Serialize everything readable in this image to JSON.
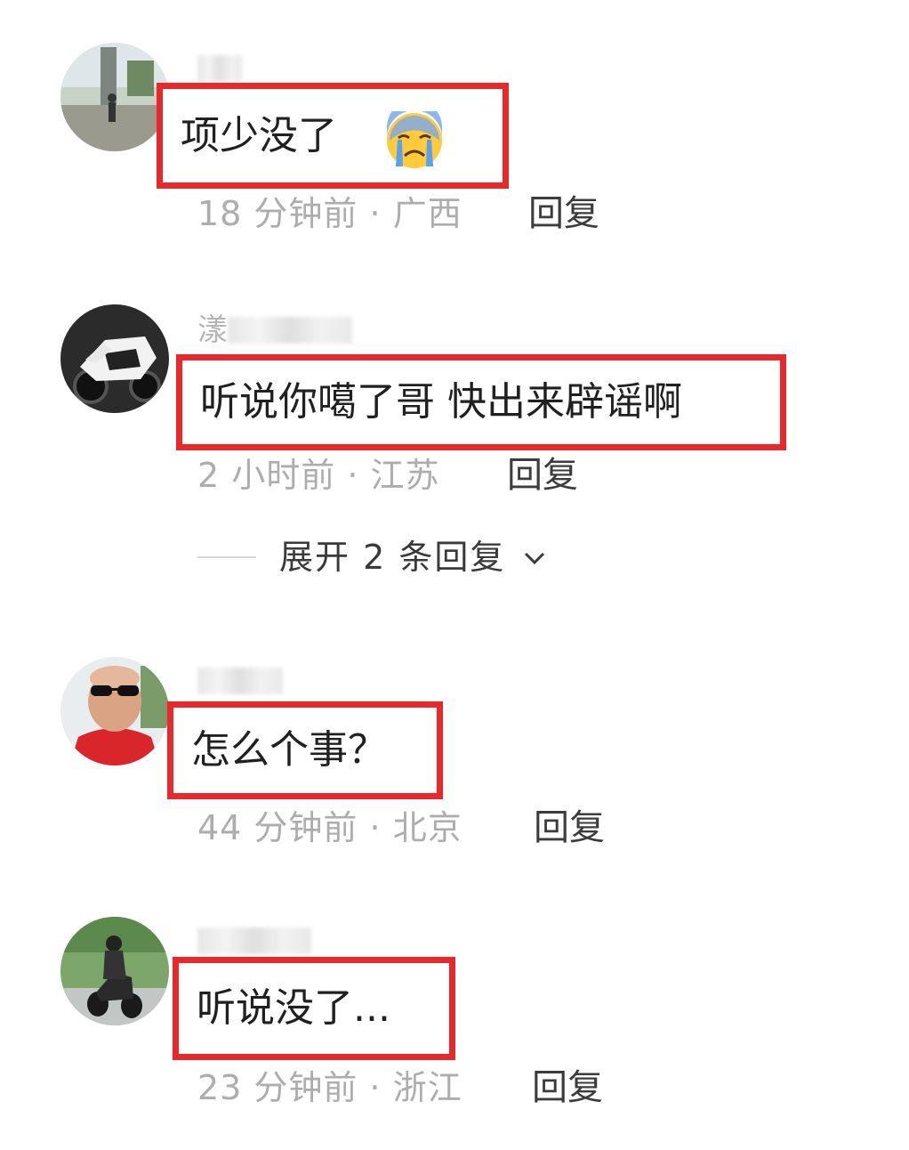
{
  "comments": [
    {
      "username": "",
      "text": "项少没了",
      "emoji": "loudly-crying-face",
      "time": "18 分钟前",
      "location": "广西",
      "reply_label": "回复"
    },
    {
      "username": "漾",
      "text": "听说你噶了哥 快出来辟谣啊",
      "time": "2 小时前",
      "location": "江苏",
      "reply_label": "回复",
      "expand_label": "展开 2 条回复"
    },
    {
      "username": "",
      "text": "怎么个事？",
      "time": "44 分钟前",
      "location": "北京",
      "reply_label": "回复"
    },
    {
      "username": "",
      "text": "听说没了...",
      "time": "23 分钟前",
      "location": "浙江",
      "reply_label": "回复"
    }
  ],
  "colors": {
    "highlight_border": "#e8282a",
    "meta_text": "#adadad",
    "comment_text": "#202020"
  }
}
